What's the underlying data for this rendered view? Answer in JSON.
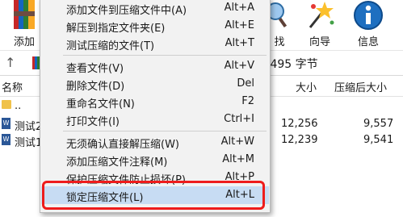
{
  "toolbar": {
    "add_label": "添加",
    "find_label": "找",
    "wizard_label": "向导",
    "info_label": "信息"
  },
  "address": {
    "up_glyph": "↑",
    "size_text": ",495 字节"
  },
  "columns": {
    "name": "名称",
    "size": "大小",
    "packed": "压缩后大小"
  },
  "files": [
    {
      "name": "..",
      "size": "",
      "packed": ""
    },
    {
      "name": "测试2",
      "size": "12,256",
      "packed": "9,557"
    },
    {
      "name": "测试1",
      "size": "12,239",
      "packed": "9,541"
    }
  ],
  "menu": {
    "items": [
      {
        "label": "添加文件到压缩文件中(A)",
        "key": "Alt+A"
      },
      {
        "label": "解压到指定文件夹(E)",
        "key": "Alt+E"
      },
      {
        "label": "测试压缩的文件(T)",
        "key": "Alt+T"
      },
      {
        "label": "查看文件(V)",
        "key": "Alt+V"
      },
      {
        "label": "删除文件(D)",
        "key": "Del"
      },
      {
        "label": "重命名文件(N)",
        "key": "F2"
      },
      {
        "label": "打印文件(I)",
        "key": "Ctrl+I"
      },
      {
        "label": "无须确认直接解压缩(W)",
        "key": "Alt+W"
      },
      {
        "label": "添加压缩文件注释(M)",
        "key": "Alt+M"
      },
      {
        "label": "保护压缩文件防止损坏(P)",
        "key": "Alt+P"
      },
      {
        "label": "锁定压缩文件(L)",
        "key": "Alt+L"
      }
    ]
  },
  "colors": {
    "highlight": "#c7dcf3",
    "callout": "#ee1c1c"
  },
  "icons": [
    "winrar-add-icon",
    "search-icon",
    "wizard-icon",
    "info-icon",
    "folder-icon",
    "word-doc-icon"
  ]
}
